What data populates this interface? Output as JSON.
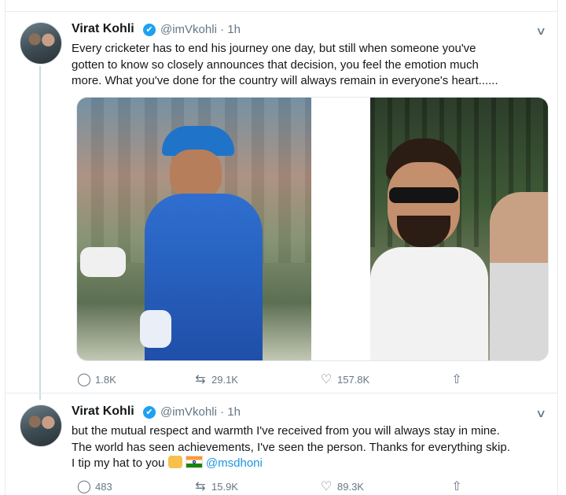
{
  "tweets": [
    {
      "name": "Virat Kohli",
      "handle": "@imVkohli",
      "time": "1h",
      "text_lines": [
        "Every cricketer has to end his journey one day, but still when someone you've",
        "gotten to know so closely announces that decision, you feel the emotion much",
        "more. What you've done for the country will always remain in everyone's heart......"
      ],
      "media": [
        "Cricketer in blue India kit and cap, smiling",
        "Selfie of Virat Kohli in sunglasses and white kit"
      ],
      "stats": {
        "replies": "1.8K",
        "retweets": "29.1K",
        "likes": "157.8K"
      }
    },
    {
      "name": "Virat Kohli",
      "handle": "@imVkohli",
      "time": "1h",
      "text_lines": [
        "but the mutual respect and warmth I've received from you will always stay in mine.",
        "The world has seen achievements, I've seen the person. Thanks for everything skip.",
        "I tip my hat to you"
      ],
      "mention": "@msdhoni",
      "emoji": [
        "clapping-hands",
        "india-flag"
      ],
      "stats": {
        "replies": "483",
        "retweets": "15.9K",
        "likes": "89.3K"
      }
    }
  ],
  "icons": {
    "verified": "✔",
    "chevron": "∨",
    "reply": "◯",
    "retweet": "⇆",
    "like": "♡",
    "share": "⇧"
  },
  "colors": {
    "accent": "#1da1f2",
    "muted": "#657786",
    "text": "#14171a"
  }
}
